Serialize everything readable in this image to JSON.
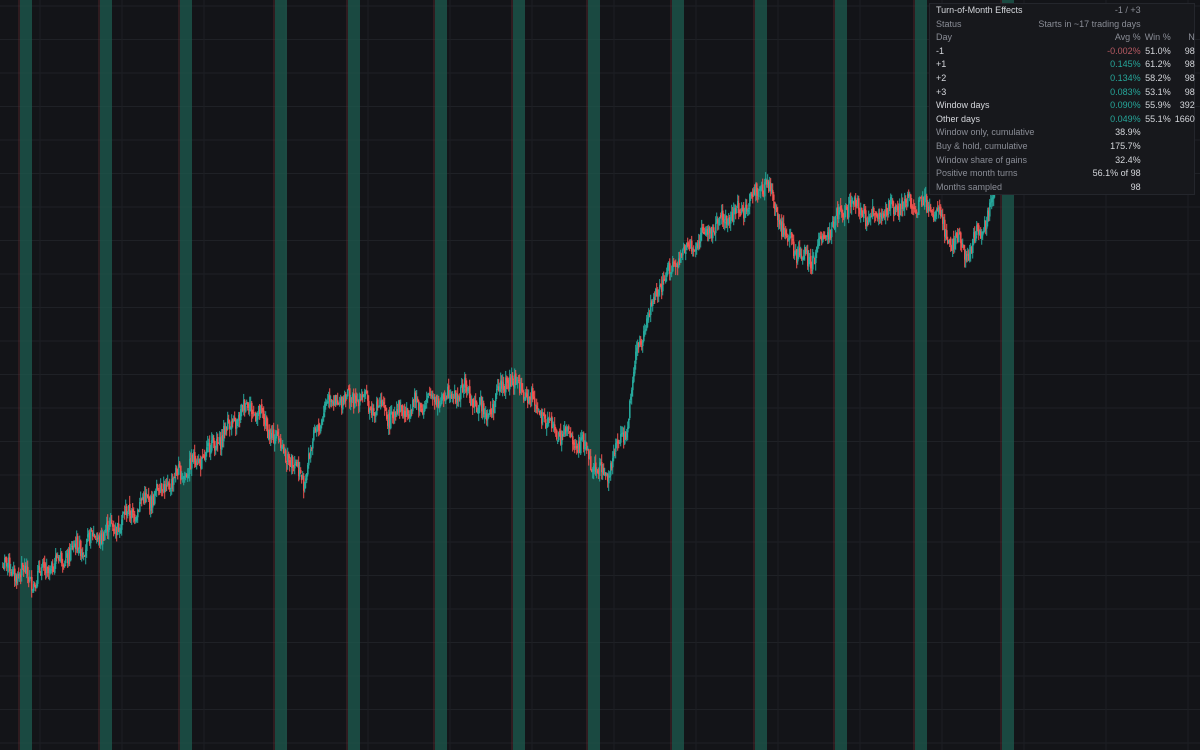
{
  "chart_data": {
    "type": "candlestick",
    "title": "",
    "xlabel": "",
    "ylabel": "",
    "grid": true,
    "ylim": [
      0,
      100
    ],
    "highlight_color": "#1d5b4f",
    "up_color": "#26a69a",
    "down_color": "#ef5350",
    "turn_of_month_windows": [
      1,
      2,
      3,
      4,
      5,
      6,
      7,
      8,
      9,
      10,
      11,
      12
    ],
    "price_path": [
      {
        "t": 0,
        "v": 18
      },
      {
        "t": 3,
        "v": 16
      },
      {
        "t": 6,
        "v": 20
      },
      {
        "t": 10,
        "v": 24
      },
      {
        "t": 13,
        "v": 28
      },
      {
        "t": 16,
        "v": 32
      },
      {
        "t": 19,
        "v": 36
      },
      {
        "t": 21,
        "v": 40
      },
      {
        "t": 23,
        "v": 44
      },
      {
        "t": 26,
        "v": 37
      },
      {
        "t": 28,
        "v": 32
      },
      {
        "t": 30,
        "v": 44
      },
      {
        "t": 33,
        "v": 45
      },
      {
        "t": 36,
        "v": 42
      },
      {
        "t": 39,
        "v": 44
      },
      {
        "t": 41,
        "v": 45
      },
      {
        "t": 43,
        "v": 46
      },
      {
        "t": 45,
        "v": 42
      },
      {
        "t": 47,
        "v": 48
      },
      {
        "t": 49,
        "v": 45
      },
      {
        "t": 51,
        "v": 40
      },
      {
        "t": 54,
        "v": 37
      },
      {
        "t": 56,
        "v": 32
      },
      {
        "t": 58,
        "v": 40
      },
      {
        "t": 59,
        "v": 52
      },
      {
        "t": 61,
        "v": 62
      },
      {
        "t": 63,
        "v": 67
      },
      {
        "t": 66,
        "v": 72
      },
      {
        "t": 69,
        "v": 75
      },
      {
        "t": 71,
        "v": 79
      },
      {
        "t": 73,
        "v": 70
      },
      {
        "t": 75,
        "v": 66
      },
      {
        "t": 77,
        "v": 72
      },
      {
        "t": 79,
        "v": 76
      },
      {
        "t": 81,
        "v": 73
      },
      {
        "t": 83,
        "v": 75
      },
      {
        "t": 85,
        "v": 76
      },
      {
        "t": 87,
        "v": 74
      },
      {
        "t": 88,
        "v": 70
      },
      {
        "t": 90,
        "v": 68
      },
      {
        "t": 92,
        "v": 75
      },
      {
        "t": 93,
        "v": 85
      },
      {
        "t": 94,
        "v": 81
      }
    ]
  },
  "stats": {
    "title": "Turn-of-Month Effects",
    "window": "-1 / +3",
    "status_label": "Status",
    "status_value": "Starts in ~17 trading days",
    "headers": {
      "day": "Day",
      "avg": "Avg %",
      "win": "Win %",
      "n": "N"
    },
    "rows": [
      {
        "day": "-1",
        "avg": "-0.002%",
        "win": "51.0%",
        "n": "98",
        "sign": "neg"
      },
      {
        "day": "+1",
        "avg": "0.145%",
        "win": "61.2%",
        "n": "98",
        "sign": "pos"
      },
      {
        "day": "+2",
        "avg": "0.134%",
        "win": "58.2%",
        "n": "98",
        "sign": "pos"
      },
      {
        "day": "+3",
        "avg": "0.083%",
        "win": "53.1%",
        "n": "98",
        "sign": "pos"
      },
      {
        "day": "Window days",
        "avg": "0.090%",
        "win": "55.9%",
        "n": "392",
        "sign": "pos"
      },
      {
        "day": "Other days",
        "avg": "0.049%",
        "win": "55.1%",
        "n": "1660",
        "sign": "pos"
      }
    ],
    "summary": [
      {
        "label": "Window only, cumulative",
        "value": "38.9%"
      },
      {
        "label": "Buy & hold, cumulative",
        "value": "175.7%"
      },
      {
        "label": "Window share of gains",
        "value": "32.4%"
      },
      {
        "label": "Positive month turns",
        "value": "56.1% of 98"
      },
      {
        "label": "Months sampled",
        "value": "98"
      }
    ]
  }
}
